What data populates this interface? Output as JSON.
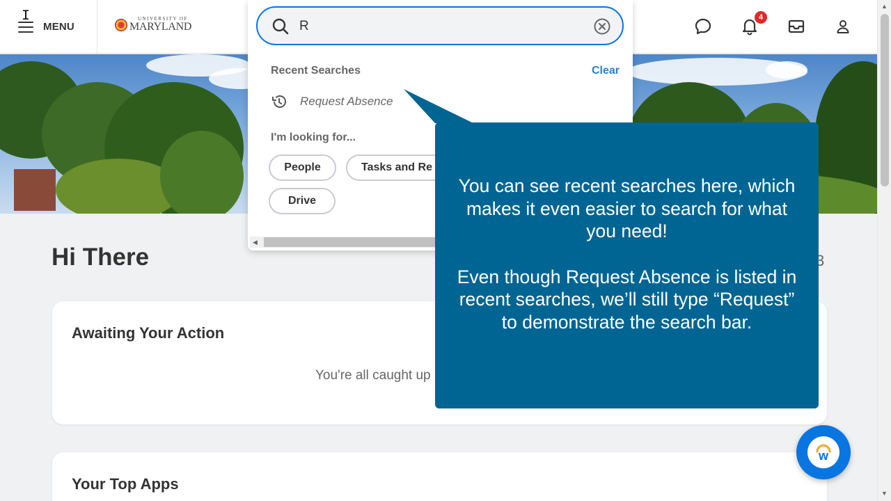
{
  "header": {
    "menu_label": "MENU",
    "logo_small": "UNIVERSITY OF",
    "logo_big": "MARYLAND",
    "notification_count": "4",
    "icons": [
      "chat-icon",
      "bell-icon",
      "inbox-icon",
      "profile-icon"
    ]
  },
  "search": {
    "value": "R",
    "recent_header": "Recent Searches",
    "clear_label": "Clear",
    "recent_items": [
      {
        "label": "Request Absence",
        "icon": "history-icon"
      }
    ],
    "looking_for_label": "I'm looking for...",
    "categories": [
      "People",
      "Tasks and Re",
      "Drive"
    ]
  },
  "main": {
    "greeting": "Hi There",
    "side_digit": "3",
    "cards": [
      {
        "title": "Awaiting Your Action",
        "message": "You're all caught up"
      },
      {
        "title": "Your Top Apps"
      }
    ]
  },
  "tooltip": {
    "paragraph1": "You can see recent searches here, which makes it even easier to search for what you need!",
    "paragraph2": "Even though Request Absence is listed in recent searches, we’ll still type “Request” to demonstrate the search bar."
  },
  "help": {
    "letter": "w"
  },
  "colors": {
    "accent": "#0875e1",
    "tooltip_bg": "#006593",
    "badge": "#de2b28",
    "clear_link": "#2b80c7"
  }
}
